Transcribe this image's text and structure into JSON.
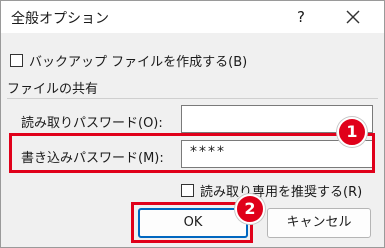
{
  "window": {
    "title": "全般オプション",
    "help_glyph": "?",
    "close_glyph": "×"
  },
  "backup": {
    "label": "バックアップ ファイルを作成する(B)",
    "checked": false
  },
  "sharing": {
    "section_label": "ファイルの共有",
    "read_password_label": "読み取りパスワード(O):",
    "read_password_value": "",
    "write_password_label": "書き込みパスワード(M):",
    "write_password_value": "****",
    "readonly_recommend_label": "読み取り専用を推奨する(R)",
    "readonly_recommend_checked": false
  },
  "buttons": {
    "ok": "OK",
    "cancel": "キャンセル"
  },
  "annotations": {
    "marker1": "1",
    "marker2": "2",
    "accent_color": "#e0001a"
  }
}
